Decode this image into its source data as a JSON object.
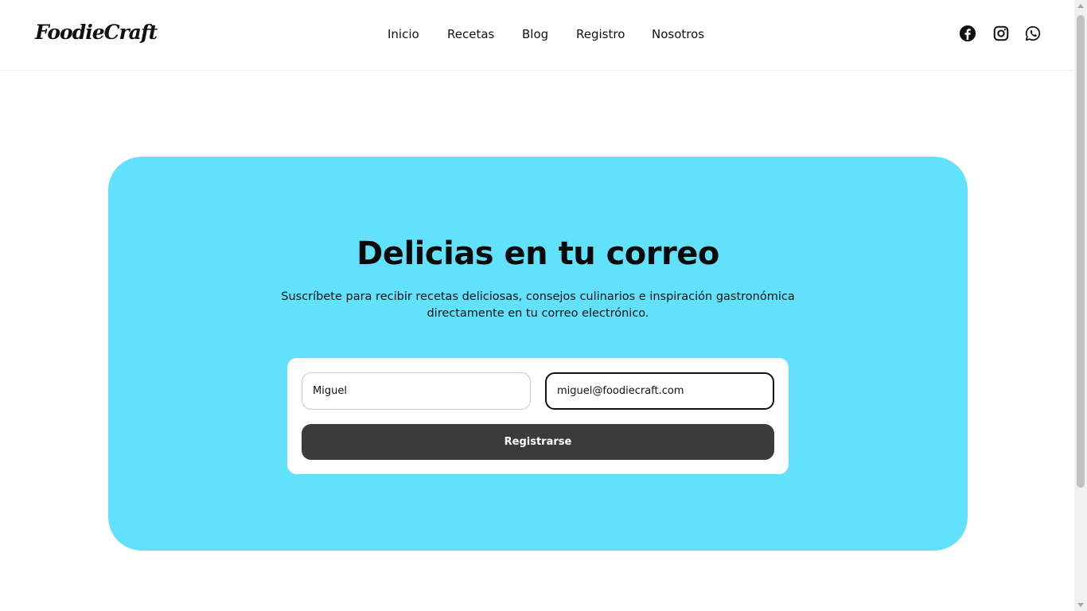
{
  "brand": {
    "logo_text": "FoodieCraft"
  },
  "nav": {
    "items": [
      {
        "label": "Inicio"
      },
      {
        "label": "Recetas"
      },
      {
        "label": "Blog"
      },
      {
        "label": "Registro"
      },
      {
        "label": "Nosotros"
      }
    ]
  },
  "social": [
    {
      "icon": "facebook-icon"
    },
    {
      "icon": "instagram-icon"
    },
    {
      "icon": "whatsapp-icon"
    }
  ],
  "newsletter": {
    "title": "Delicias en tu correo",
    "subtitle_line1": "Suscríbete para recibir recetas deliciosas, consejos culinarios e inspiración gastronómica",
    "subtitle_line2": "directamente en tu correo electrónico.",
    "name_value": "Miguel",
    "email_value": "miguel@foodiecraft.com",
    "submit_label": "Registrarse"
  },
  "colors": {
    "card_bg": "#62e1fd",
    "button_bg": "#3b3b3b",
    "text": "#111111"
  }
}
